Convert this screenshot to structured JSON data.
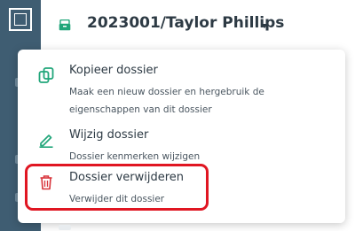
{
  "header": {
    "dossier_title": "2023001/Taylor Phillips",
    "dossier_icon": "archive-box-icon",
    "accent_color": "#21a67a"
  },
  "menu": {
    "items": [
      {
        "label": "Kopieer dossier",
        "description": "Maak een nieuw dossier en hergebruik de eigenschappen van dit dossier",
        "icon": "copy-icon"
      },
      {
        "label": "Wijzig dossier",
        "description": "Dossier kenmerken wijzigen",
        "icon": "pencil-icon"
      },
      {
        "label": "Dossier verwijderen",
        "description": "Verwijder dit dossier",
        "icon": "trash-icon"
      }
    ]
  },
  "colors": {
    "sidebar": "#3f5d72",
    "icon_green": "#21a67a",
    "icon_red": "#d8343b",
    "highlight": "#e01622"
  }
}
